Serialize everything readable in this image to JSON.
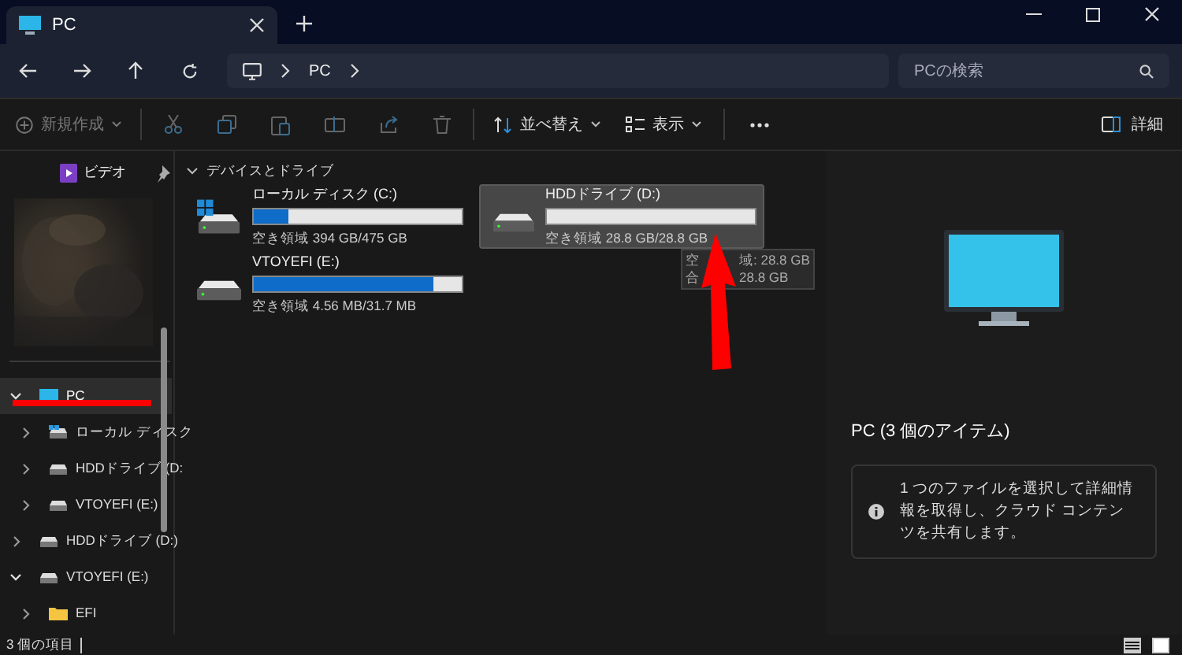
{
  "tab": {
    "title": "PC"
  },
  "address": {
    "breadcrumb": [
      "PC"
    ],
    "search_placeholder": "PCの検索"
  },
  "toolbar": {
    "new": {
      "label": "新規作成",
      "disabled": true
    },
    "sort": {
      "label": "並べ替え"
    },
    "view": {
      "label": "表示"
    },
    "details": {
      "label": "詳細"
    }
  },
  "sidebar": {
    "pinned": [
      {
        "label": "ビデオ"
      }
    ],
    "tree": [
      {
        "label": "PC",
        "kind": "pc",
        "expanded": true,
        "selected": true,
        "children": [
          {
            "label": "ローカル ディスク",
            "kind": "windrive",
            "expanded": false,
            "selected": false
          },
          {
            "label": "HDDドライブ (D:",
            "kind": "drive",
            "expanded": false,
            "selected": false
          },
          {
            "label": "VTOYEFI (E:)",
            "kind": "drive",
            "expanded": false,
            "selected": false
          }
        ]
      },
      {
        "label": "HDDドライブ (D:)",
        "kind": "drive",
        "expanded": false,
        "selected": false
      },
      {
        "label": "VTOYEFI (E:)",
        "kind": "drive",
        "expanded": true,
        "selected": false,
        "children": [
          {
            "label": "EFI",
            "kind": "folder",
            "expanded": false,
            "selected": false
          }
        ]
      }
    ]
  },
  "section": {
    "title": "デバイスとドライブ",
    "expanded": true
  },
  "drives": [
    {
      "name": "ローカル ディスク (C:)",
      "kind": "windrive",
      "level": 0.17,
      "free": "空き領域 394 GB/475 GB",
      "selected": false
    },
    {
      "name": "HDDドライブ (D:)",
      "kind": "drive",
      "level": 0,
      "free": "空き領域 28.8 GB/28.8 GB",
      "selected": true
    },
    {
      "name": "VTOYEFI (E:)",
      "kind": "drive",
      "level": 0.86,
      "free": "空き領域 4.56 MB/31.7 MB",
      "selected": false
    }
  ],
  "tooltip": {
    "lines": [
      [
        "空",
        "域: 28.8 GB"
      ],
      [
        "合",
        "28.8 GB"
      ]
    ]
  },
  "details_pane": {
    "title": "PC (3 個のアイテム)",
    "info": "1 つのファイルを選択して詳細情報を取得し、クラウド コンテンツを共有します。"
  },
  "status_bar": {
    "count": "3 個の項目"
  }
}
